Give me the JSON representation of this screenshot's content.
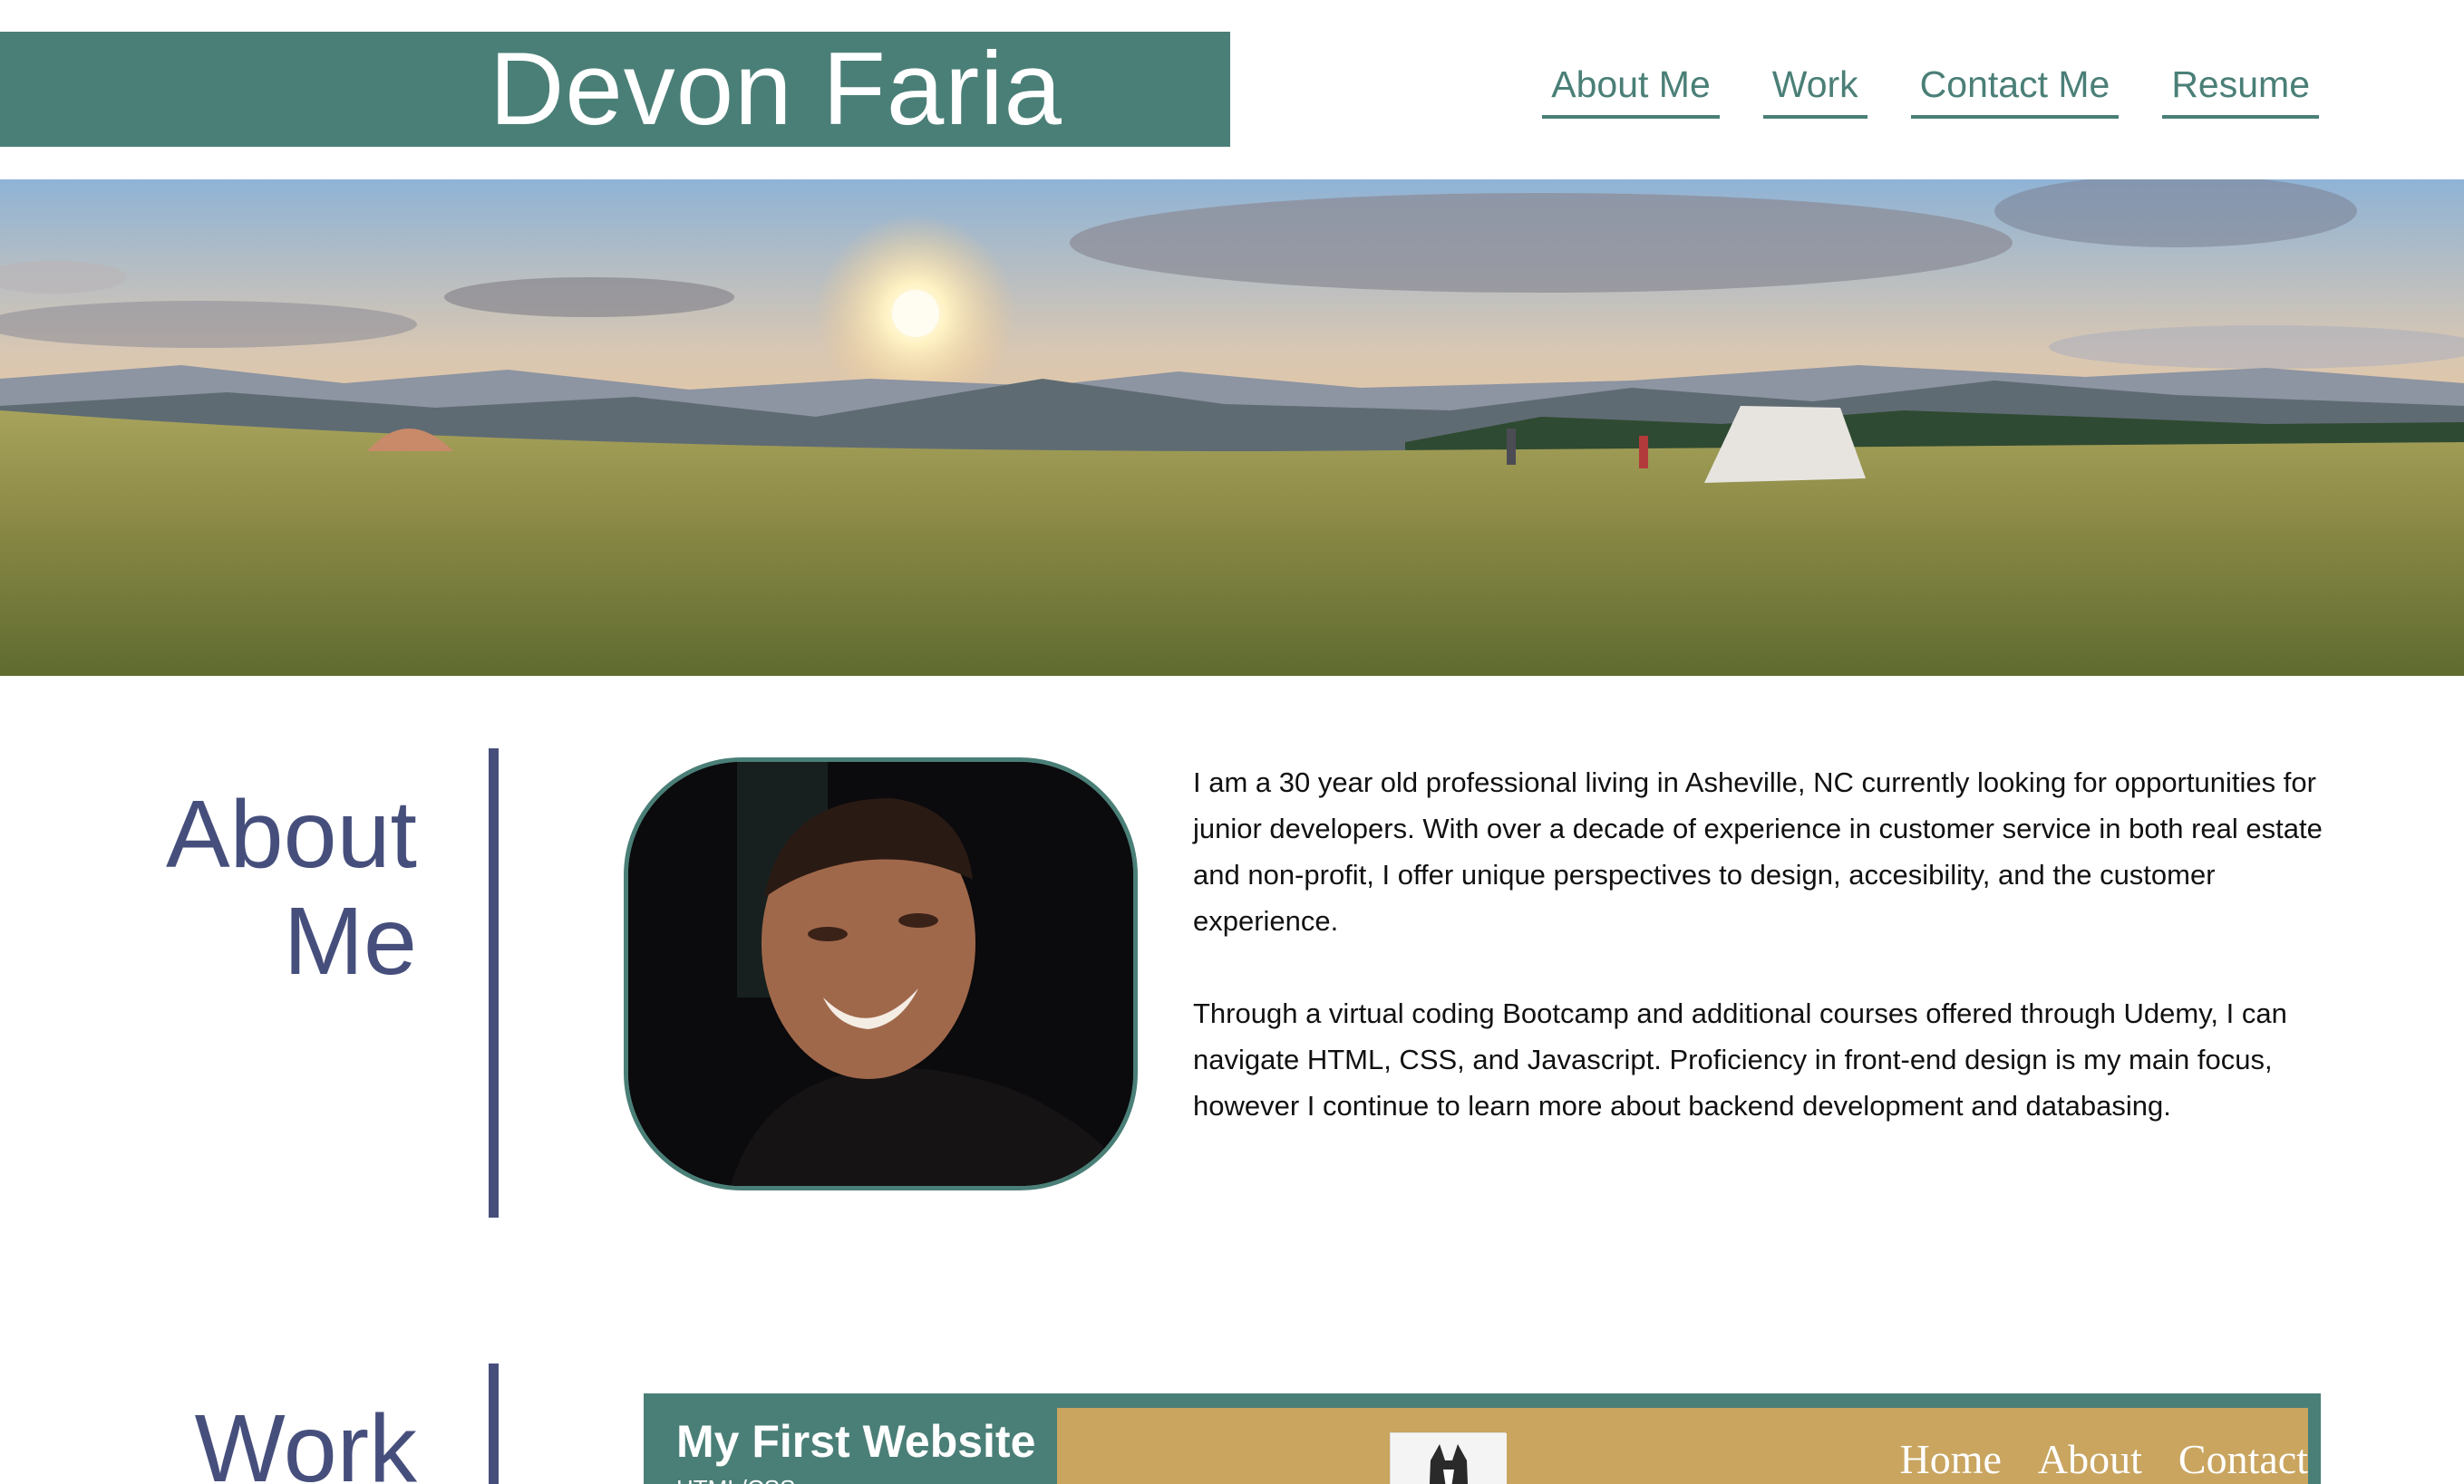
{
  "header": {
    "site_title": "Devon Faria",
    "nav": [
      {
        "label": "About Me"
      },
      {
        "label": "Work"
      },
      {
        "label": "Contact Me"
      },
      {
        "label": "Resume"
      }
    ]
  },
  "about": {
    "heading_line1": "About",
    "heading_line2": "Me",
    "paragraphs": [
      "I am a 30 year old professional living in Asheville, NC currently looking for opportunities for junior developers. With over a decade of experience in customer service in both real estate and non-profit, I offer unique perspectives to design, accesibility, and the customer experience.",
      "Through a virtual coding Bootcamp and additional courses offered through Udemy, I can navigate HTML, CSS, and Javascript. Proficiency in front-end design is my main focus, however I continue to learn more about backend development and databasing."
    ]
  },
  "work": {
    "heading": "Work",
    "projects": [
      {
        "title": "My First Website",
        "subtitle": "HTML/CSS",
        "preview_nav": [
          "Home",
          "About",
          "Contact"
        ]
      }
    ]
  },
  "colors": {
    "accent_teal": "#4a7f77",
    "heading_navy": "#464f7c",
    "preview_gold": "#c9a560"
  },
  "icons": {
    "hero": "landscape-photo",
    "portrait": "profile-photo"
  }
}
